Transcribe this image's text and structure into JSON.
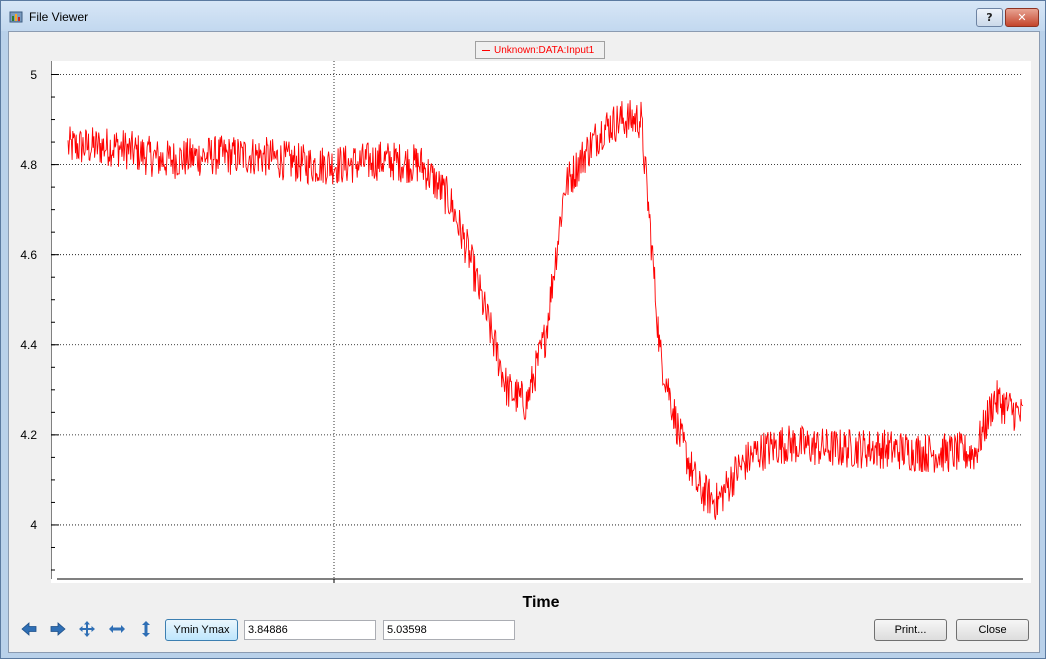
{
  "window": {
    "title": "File Viewer",
    "help_label": "?",
    "close_label": "✕"
  },
  "legend": {
    "label": "Unknown:DATA:Input1",
    "color": "#ff0000"
  },
  "toolbar": {
    "icons": [
      "arrow-left-icon",
      "arrow-right-icon",
      "pan-icon",
      "horizontal-zoom-icon",
      "vertical-zoom-icon"
    ],
    "ymin_ymax_label": "Ymin Ymax",
    "ymin_value": "3.84886",
    "ymax_value": "5.03598",
    "print_label": "Print...",
    "close_label": "Close"
  },
  "chart_data": {
    "type": "line",
    "xlabel": "Time",
    "ylabel": "",
    "ylim": [
      3.88,
      5.03
    ],
    "yticks": [
      "4",
      "4.2",
      "4.4",
      "4.6",
      "4.8",
      "5"
    ],
    "grid": true,
    "legend_position": "top-center",
    "series": [
      {
        "name": "Unknown:DATA:Input1",
        "color": "#ff0000",
        "x": [
          0,
          0.05,
          0.1,
          0.15,
          0.2,
          0.25,
          0.29,
          0.33,
          0.37,
          0.4,
          0.42,
          0.44,
          0.46,
          0.48,
          0.5,
          0.52,
          0.54,
          0.56,
          0.58,
          0.6,
          0.61,
          0.62,
          0.64,
          0.66,
          0.68,
          0.7,
          0.72,
          0.75,
          0.8,
          0.85,
          0.9,
          0.95,
          0.97,
          1.0
        ],
        "values": [
          4.84,
          4.84,
          4.81,
          4.82,
          4.82,
          4.8,
          4.8,
          4.81,
          4.8,
          4.72,
          4.6,
          4.45,
          4.3,
          4.27,
          4.42,
          4.75,
          4.82,
          4.88,
          4.9,
          4.9,
          4.65,
          4.38,
          4.2,
          4.08,
          4.05,
          4.12,
          4.16,
          4.18,
          4.17,
          4.17,
          4.16,
          4.16,
          4.28,
          4.24
        ]
      }
    ]
  }
}
